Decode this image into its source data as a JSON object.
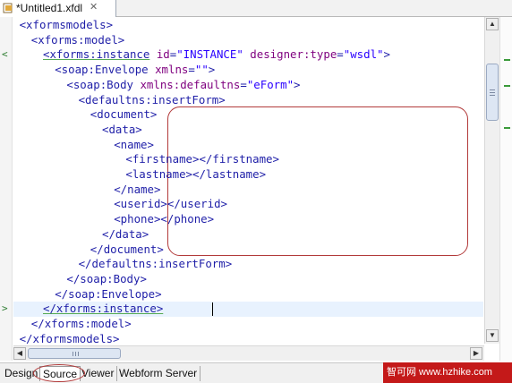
{
  "editor_tab": {
    "title": "*Untitled1.xfdl",
    "close_glyph": "✕",
    "icon": "xfdl-file-icon"
  },
  "code_lines": [
    {
      "indent": 1,
      "parts": [
        [
          "t",
          "<xformsmodels>"
        ]
      ]
    },
    {
      "indent": 3,
      "parts": [
        [
          "t",
          "<xforms:model>"
        ]
      ]
    },
    {
      "indent": 5,
      "parts": [
        [
          "ul",
          "<xforms:instance"
        ],
        [
          "t",
          " "
        ],
        [
          "an",
          "id"
        ],
        [
          "t",
          "="
        ],
        [
          "av",
          "\"INSTANCE\""
        ],
        [
          "t",
          " "
        ],
        [
          "an",
          "designer:type"
        ],
        [
          "t",
          "="
        ],
        [
          "av",
          "\"wsdl\""
        ],
        [
          "t",
          ">"
        ]
      ]
    },
    {
      "indent": 7,
      "parts": [
        [
          "t",
          "<soap:Envelope "
        ],
        [
          "an",
          "xmlns"
        ],
        [
          "t",
          "="
        ],
        [
          "av",
          "\"\""
        ],
        [
          "t",
          ">"
        ]
      ]
    },
    {
      "indent": 9,
      "parts": [
        [
          "t",
          "<soap:Body "
        ],
        [
          "an",
          "xmlns:defaultns"
        ],
        [
          "t",
          "="
        ],
        [
          "av",
          "\"eForm\""
        ],
        [
          "t",
          ">"
        ]
      ]
    },
    {
      "indent": 11,
      "parts": [
        [
          "t",
          "<defaultns:insertForm>"
        ]
      ]
    },
    {
      "indent": 13,
      "parts": [
        [
          "t",
          "<document>"
        ]
      ]
    },
    {
      "indent": 15,
      "parts": [
        [
          "t",
          "<data>"
        ]
      ]
    },
    {
      "indent": 17,
      "parts": [
        [
          "t",
          "<name>"
        ]
      ]
    },
    {
      "indent": 19,
      "parts": [
        [
          "t",
          "<firstname></firstname>"
        ]
      ]
    },
    {
      "indent": 19,
      "parts": [
        [
          "t",
          "<lastname></lastname>"
        ]
      ]
    },
    {
      "indent": 17,
      "parts": [
        [
          "t",
          "</name>"
        ]
      ]
    },
    {
      "indent": 17,
      "parts": [
        [
          "t",
          "<userid></userid>"
        ]
      ]
    },
    {
      "indent": 17,
      "parts": [
        [
          "t",
          "<phone></phone>"
        ]
      ]
    },
    {
      "indent": 15,
      "parts": [
        [
          "t",
          "</data>"
        ]
      ]
    },
    {
      "indent": 13,
      "parts": [
        [
          "t",
          "</document>"
        ]
      ]
    },
    {
      "indent": 11,
      "parts": [
        [
          "t",
          "</defaultns:insertForm>"
        ]
      ]
    },
    {
      "indent": 9,
      "parts": [
        [
          "t",
          "</soap:Body>"
        ]
      ]
    },
    {
      "indent": 7,
      "parts": [
        [
          "t",
          "</soap:Envelope>"
        ]
      ]
    },
    {
      "indent": 5,
      "parts": [
        [
          "ul",
          "</xforms:instance>"
        ]
      ]
    },
    {
      "indent": 3,
      "parts": [
        [
          "t",
          "</xforms:model>"
        ]
      ]
    },
    {
      "indent": 1,
      "parts": [
        [
          "t",
          "</xformsmodels>"
        ]
      ]
    }
  ],
  "ruler_marks": [
    {
      "line": 2,
      "glyph": "<"
    },
    {
      "line": 19,
      "glyph": ">"
    }
  ],
  "bottom_tabs": [
    {
      "label": "Design",
      "active": false
    },
    {
      "label": "Source",
      "active": true
    },
    {
      "label": "Viewer",
      "active": false
    },
    {
      "label": "Webform Server",
      "active": false
    }
  ],
  "watermark": {
    "text": "智可网 www.hzhike.com"
  },
  "colors": {
    "tag": "#1f1fa8",
    "attr_name": "#7f007f",
    "attr_value": "#2a00ff",
    "annotation": "#b23a3a",
    "current_line": "#e8f2fe"
  }
}
